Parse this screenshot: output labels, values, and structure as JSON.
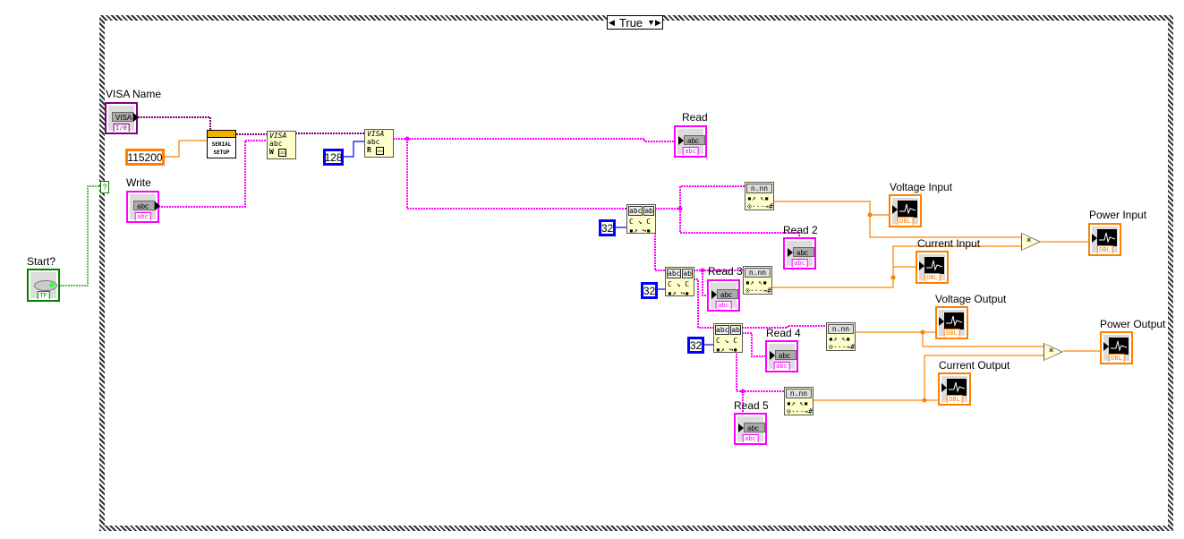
{
  "case_structure": {
    "selector_value": "True",
    "selector_terminal": "?"
  },
  "controls": {
    "visa_name": {
      "label": "VISA Name",
      "glyph": "VISA",
      "type_tag": "I/0"
    },
    "write": {
      "label": "Write",
      "glyph": "abc",
      "type_tag": "abc"
    },
    "start": {
      "label": "Start?",
      "type_tag": "TF"
    }
  },
  "constants": {
    "baud_rate": "115200",
    "byte_count": "128",
    "scan_1_count": "32",
    "scan_2_count": "32",
    "scan_3_count": "32"
  },
  "functions": {
    "serial_setup": {
      "line1": "SERIAL",
      "line2": "SETUP"
    },
    "visa_write": {
      "title": "VISA",
      "sub": "abc",
      "mode": "W"
    },
    "visa_read": {
      "title": "VISA",
      "sub": "abc",
      "mode": "R"
    },
    "scan_string": {
      "left": "abc",
      "right": "ab"
    },
    "frac_to_number": {
      "title": "n.nn"
    },
    "multiply": "×"
  },
  "indicators": {
    "read": {
      "label": "Read",
      "glyph": "abc",
      "type_tag": "abc"
    },
    "read_2": {
      "label": "Read 2",
      "glyph": "abc",
      "type_tag": "abc"
    },
    "read_3": {
      "label": "Read 3",
      "glyph": "abc",
      "type_tag": "abc"
    },
    "read_4": {
      "label": "Read 4",
      "glyph": "abc",
      "type_tag": "abc"
    },
    "read_5": {
      "label": "Read 5",
      "glyph": "abc",
      "type_tag": "abc"
    },
    "voltage_input": {
      "label": "Voltage Input",
      "type_tag": "DBL"
    },
    "current_input": {
      "label": "Current Input",
      "type_tag": "DBL"
    },
    "power_input": {
      "label": "Power Input",
      "type_tag": "DBL"
    },
    "voltage_output": {
      "label": "Voltage Output",
      "type_tag": "DBL"
    },
    "current_output": {
      "label": "Current Output",
      "type_tag": "DBL"
    },
    "power_output": {
      "label": "Power Output",
      "type_tag": "DBL"
    }
  },
  "colors": {
    "string": "#ff00ff",
    "visa": "#800080",
    "double": "#ff8000",
    "integer": "#0000ff",
    "boolean": "#008000"
  }
}
